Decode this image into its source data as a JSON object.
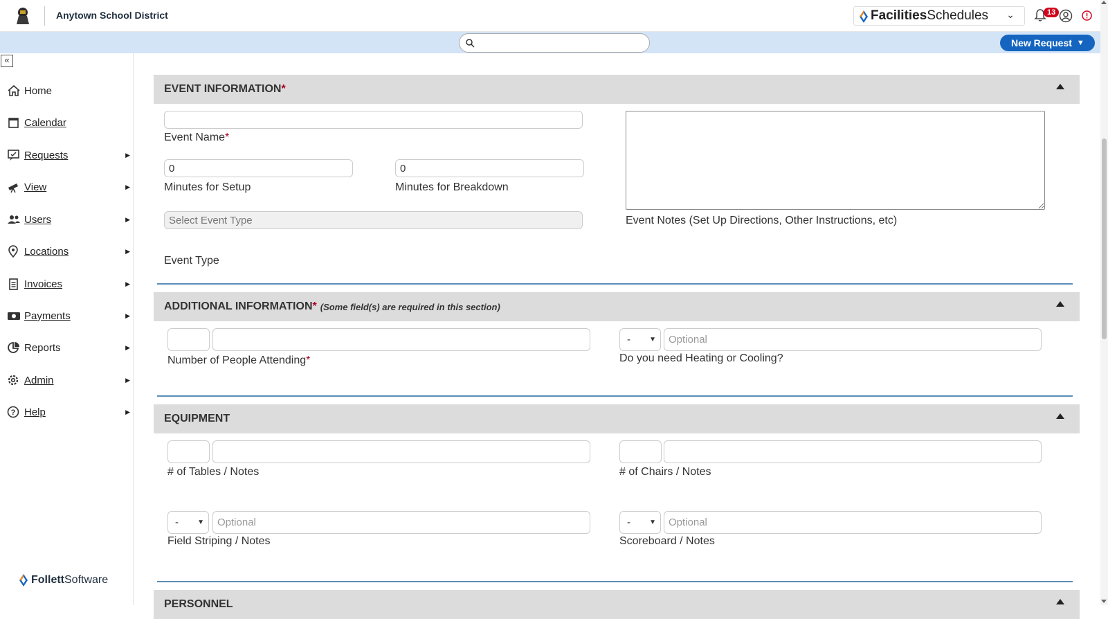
{
  "header": {
    "district_name": "Anytown School District",
    "product_name_bold": "Facilities",
    "product_name_rest": " Schedules",
    "notification_count": "13"
  },
  "toolbar": {
    "search_placeholder": "",
    "new_request_label": "New Request"
  },
  "sidebar": {
    "collapse_label": "«",
    "items": [
      {
        "label": "Home",
        "has_submenu": false
      },
      {
        "label": "Calendar",
        "has_submenu": false
      },
      {
        "label": "Requests",
        "has_submenu": true
      },
      {
        "label": "View",
        "has_submenu": true
      },
      {
        "label": "Users",
        "has_submenu": true
      },
      {
        "label": "Locations",
        "has_submenu": true
      },
      {
        "label": "Invoices",
        "has_submenu": true
      },
      {
        "label": "Payments",
        "has_submenu": true
      },
      {
        "label": "Reports",
        "has_submenu": true
      },
      {
        "label": "Admin",
        "has_submenu": true
      },
      {
        "label": "Help",
        "has_submenu": true
      }
    ],
    "footer_brand_bold": "Follett",
    "footer_brand_rest": " Software"
  },
  "event_information": {
    "title": "EVENT INFORMATION",
    "event_name_value": "",
    "event_name_label": "Event Name",
    "setup_value": "0",
    "setup_label": "Minutes for Setup",
    "breakdown_value": "0",
    "breakdown_label": "Minutes for Breakdown",
    "event_type_placeholder": "Select Event Type",
    "event_type_label": "Event Type",
    "notes_label": "Event Notes (Set Up Directions, Other Instructions, etc)"
  },
  "additional_information": {
    "title": "ADDITIONAL INFORMATION",
    "note": "(Some field(s) are required in this section)",
    "people_label": "Number of People Attending",
    "hvac_select_value": "-",
    "hvac_notes_placeholder": "Optional",
    "hvac_label": "Do you need Heating or Cooling?"
  },
  "equipment": {
    "title": "EQUIPMENT",
    "tables_label": "# of Tables / Notes",
    "chairs_label": "# of Chairs / Notes",
    "striping_select_value": "-",
    "striping_notes_placeholder": "Optional",
    "striping_label": "Field Striping / Notes",
    "scoreboard_select_value": "-",
    "scoreboard_notes_placeholder": "Optional",
    "scoreboard_label": "Scoreboard / Notes"
  },
  "personnel": {
    "title": "PERSONNEL"
  },
  "colors": {
    "accent": "#1565c0",
    "strip": "#d4e4f7",
    "required": "#b00020",
    "section_header": "#dcdcdc"
  }
}
